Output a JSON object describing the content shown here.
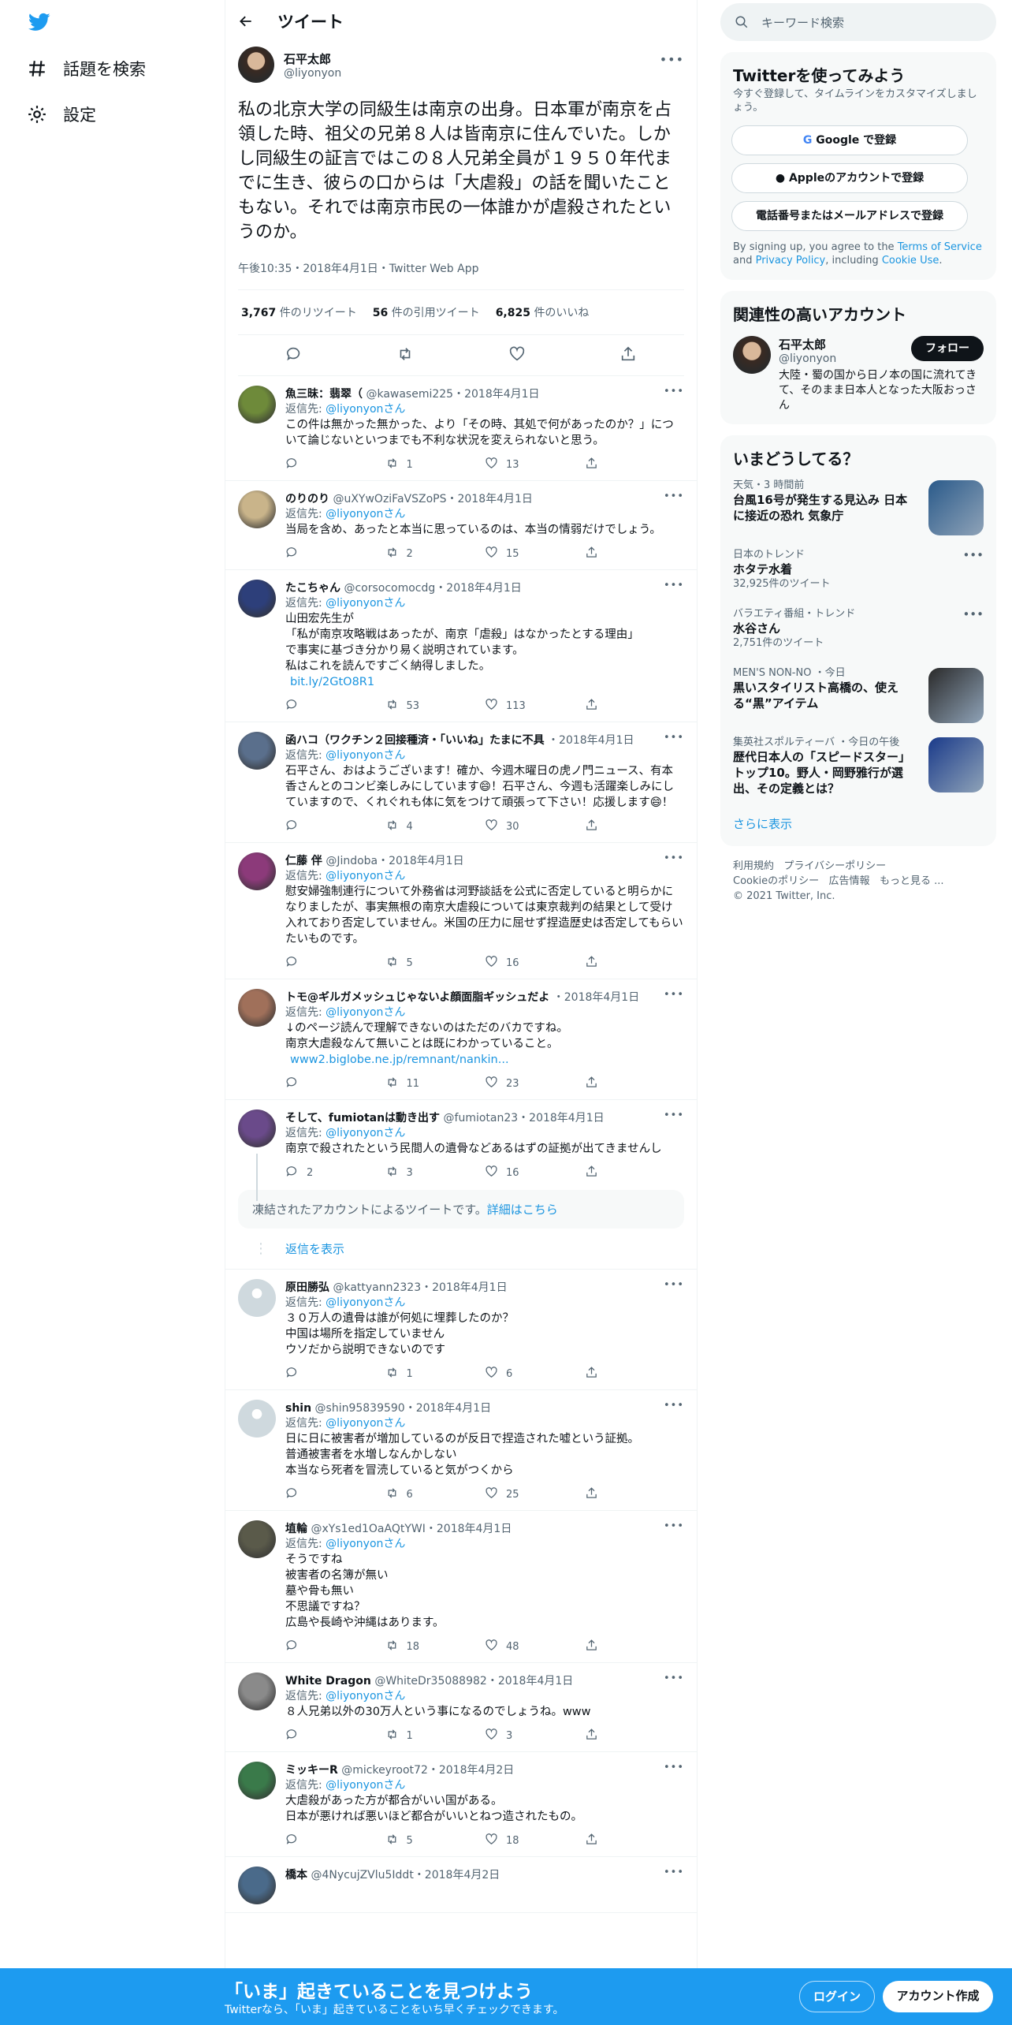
{
  "nav": {
    "explore": "話題を検索",
    "settings": "設定"
  },
  "header": {
    "title": "ツイート"
  },
  "main_tweet": {
    "name": "石平太郎",
    "handle": "@liyonyon",
    "text": "私の北京大学の同級生は南京の出身。日本軍が南京を占領した時、祖父の兄弟８人は皆南京に住んでいた。しかし同級生の証言ではこの８人兄弟全員が１９５０年代までに生き、彼らの口からは「大虐殺」の話を聞いたこともない。それでは南京市民の一体誰かが虐殺されたというのか。",
    "meta": "午後10:35・2018年4月1日・Twitter Web App",
    "retweets": "3,767",
    "retweets_label": "件のリツイート",
    "quotes": "56",
    "quotes_label": "件の引用ツイート",
    "likes": "6,825",
    "likes_label": "件のいいね"
  },
  "reply_to": {
    "prefix": "返信先: ",
    "handle": "@liyonyonさん"
  },
  "replies": [
    {
      "name": "魚三昧：翡翠（",
      "handle": "@kawasemi225",
      "date": "・2018年4月1日",
      "text": "この件は無かった無かった、より「その時、其処で何があったのか？」について論じないといつまでも不利な状況を変えられないと思う。",
      "link": "",
      "replies": "",
      "retweets": "1",
      "likes": "13",
      "color": "#6e8a3a"
    },
    {
      "name": "のりのり",
      "handle": "@uXYwOziFaVSZoPS",
      "date": "・2018年4月1日",
      "text": "当局を含め、あったと本当に思っているのは、本当の情弱だけでしょう。",
      "link": "",
      "replies": "",
      "retweets": "2",
      "likes": "15",
      "color": "#c9b48a"
    },
    {
      "name": "たこちゃん",
      "handle": "@corsocomocdg",
      "date": "・2018年4月1日",
      "text": "山田宏先生が\n「私が南京攻略戦はあったが、南京「虐殺」はなかったとする理由」\nで事実に基づき分かり易く説明されています。\n私はこれを読んですごく納得しました。",
      "link": "bit.ly/2GtO8R1",
      "replies": "",
      "retweets": "53",
      "likes": "113",
      "color": "#2d3f7a"
    },
    {
      "name": "函ハコ（ワクチン２回接種済・「いいね」たまに不具",
      "handle": "",
      "date": "・2018年4月1日",
      "text": "石平さん、おはようございます！確か、今週木曜日の虎ノ門ニュース、有本香さんとのコンビ楽しみにしています😄！石平さん、今週も活躍楽しみにしていますので、くれぐれも体に気をつけて頑張って下さい！応援します😄！",
      "link": "",
      "replies": "",
      "retweets": "4",
      "likes": "30",
      "color": "#5a6f8c"
    },
    {
      "name": "仁藤 伴",
      "handle": "@Jindoba",
      "date": "・2018年4月1日",
      "text": "慰安婦強制連行について外務省は河野談話を公式に否定していると明らかになりましたが、事実無根の南京大虐殺については東京裁判の結果として受け入れており否定していません。米国の圧力に屈せず捏造歴史は否定してもらいたいものです。",
      "link": "",
      "replies": "",
      "retweets": "5",
      "likes": "16",
      "color": "#8c3a7a"
    },
    {
      "name": "トモ@ギルガメッシュじゃないよ顔面脂ギッシュだよ",
      "handle": "",
      "date": "・2018年4月1日",
      "text": "↓のページ読んで理解できないのはただのバカですね。\n南京大虐殺なんて無いことは既にわかっていること。\n ",
      "link": "www2.biglobe.ne.jp/remnant/nankin...",
      "replies": "",
      "retweets": "11",
      "likes": "23",
      "color": "#a0705a"
    },
    {
      "name": "そして、fumiotanは動き出す",
      "handle": "@fumiotan23",
      "date": "・2018年4月1日",
      "text": "南京で殺されたという民間人の遺骨などあるはずの証拠が出てきませんし",
      "link": "",
      "replies": "2",
      "retweets": "3",
      "likes": "16",
      "color": "#6a4a8a"
    }
  ],
  "suspended": {
    "text": "凍結されたアカウントによるツイートです。",
    "link": "詳細はこちら"
  },
  "show_replies": "返信を表示",
  "replies2": [
    {
      "name": "原田勝弘",
      "handle": "@kattyann2323",
      "date": "・2018年4月1日",
      "text": "３０万人の遺骨は誰が何処に埋葬したのか？\n中国は場所を指定していません\nウソだから説明できないのです",
      "link": "",
      "replies": "",
      "retweets": "1",
      "likes": "6",
      "color": "#cfd9de"
    },
    {
      "name": "shin",
      "handle": "@shin95839590",
      "date": "・2018年4月1日",
      "text": "日に日に被害者が増加しているのが反日で捏造された嘘という証拠。\n普通被害者を水増しなんかしない\n本当なら死者を冒涜していると気がつくから",
      "link": "",
      "replies": "",
      "retweets": "6",
      "likes": "25",
      "color": "#cfd9de"
    },
    {
      "name": "埴輪",
      "handle": "@xYs1ed1OaAQtYWI",
      "date": "・2018年4月1日",
      "text": "そうですね\n被害者の名簿が無い\n墓や骨も無い\n不思議ですね？\n広島や長崎や沖縄はあります。",
      "link": "",
      "replies": "",
      "retweets": "18",
      "likes": "48",
      "color": "#5a5a4a"
    },
    {
      "name": "White Dragon",
      "handle": "@WhiteDr35088982",
      "date": "・2018年4月1日",
      "text": "８人兄弟以外の30万人という事になるのでしょうね。www",
      "link": "",
      "replies": "",
      "retweets": "1",
      "likes": "3",
      "color": "#8a8a8a"
    },
    {
      "name": "ミッキーR",
      "handle": "@mickeyroot72",
      "date": "・2018年4月2日",
      "text": "大虐殺があった方が都合がいい国がある。\n日本が悪ければ悪いほど都合がいいとねつ造されたもの。",
      "link": "",
      "replies": "",
      "retweets": "5",
      "likes": "18",
      "color": "#3a7a4a"
    },
    {
      "name": "橋本",
      "handle": "@4NycujZVlu5Iddt",
      "date": "・2018年4月2日",
      "text": "",
      "link": "",
      "replies": "",
      "retweets": "",
      "likes": "",
      "color": "#4a6a8a"
    }
  ],
  "search": {
    "placeholder": "キーワード検索"
  },
  "signup": {
    "title": "Twitterを使ってみよう",
    "subtitle": "今すぐ登録して、タイムラインをカスタマイズしましょう。",
    "google": "Google で登録",
    "apple": "Appleのアカウントで登録",
    "phone": "電話番号またはメールアドレスで登録",
    "legal_1": "By signing up, you agree to the ",
    "tos": "Terms of Service",
    "legal_2": " and ",
    "privacy": "Privacy Policy",
    "legal_3": ", including ",
    "cookie": "Cookie Use",
    "legal_4": "."
  },
  "related": {
    "title": "関連性の高いアカウント",
    "name": "石平太郎",
    "handle": "@liyonyon",
    "follow": "フォロー",
    "bio": "大陸・蜀の国から日ノ本の国に流れてきて、そのまま日本人となった大阪おっさん"
  },
  "trends": {
    "title": "いまどうしてる？",
    "items": [
      {
        "context": "天気・3 時間前",
        "title": "台風16号が発生する見込み 日本に接近の恐れ 気象庁",
        "count": "",
        "thumb": "#2a5a8a"
      },
      {
        "context": "日本のトレンド",
        "title": "ホタテ水着",
        "count": "32,925件のツイート",
        "thumb": ""
      },
      {
        "context": "バラエティ番組・トレンド",
        "title": "水谷さん",
        "count": "2,751件のツイート",
        "thumb": ""
      },
      {
        "context": "MEN'S NON-NO ・今日",
        "title": "黒いスタイリスト高橋の、使える“黒”アイテム",
        "count": "",
        "thumb": "#2a2a2a"
      },
      {
        "context": "集英社スポルティーバ ・今日の午後",
        "title": "歴代日本人の「スピードスター」トップ10。野人・岡野雅行が選出、その定義とは？",
        "count": "",
        "thumb": "#1a3a8a"
      }
    ],
    "more": "さらに表示"
  },
  "footer": {
    "l1": "利用規約",
    "l2": "プライバシーポリシー",
    "l3": "Cookieのポリシー",
    "l4": "広告情報",
    "l5": "もっと見る ...",
    "copy": "© 2021 Twitter, Inc."
  },
  "bottom": {
    "title": "「いま」起きていることを見つけよう",
    "sub": "Twitterなら、「いま」起きていることをいち早くチェックできます。",
    "login": "ログイン",
    "signup": "アカウント作成"
  },
  "colors": {
    "accent": "#1d9bf0",
    "link": "#1b95e0"
  }
}
